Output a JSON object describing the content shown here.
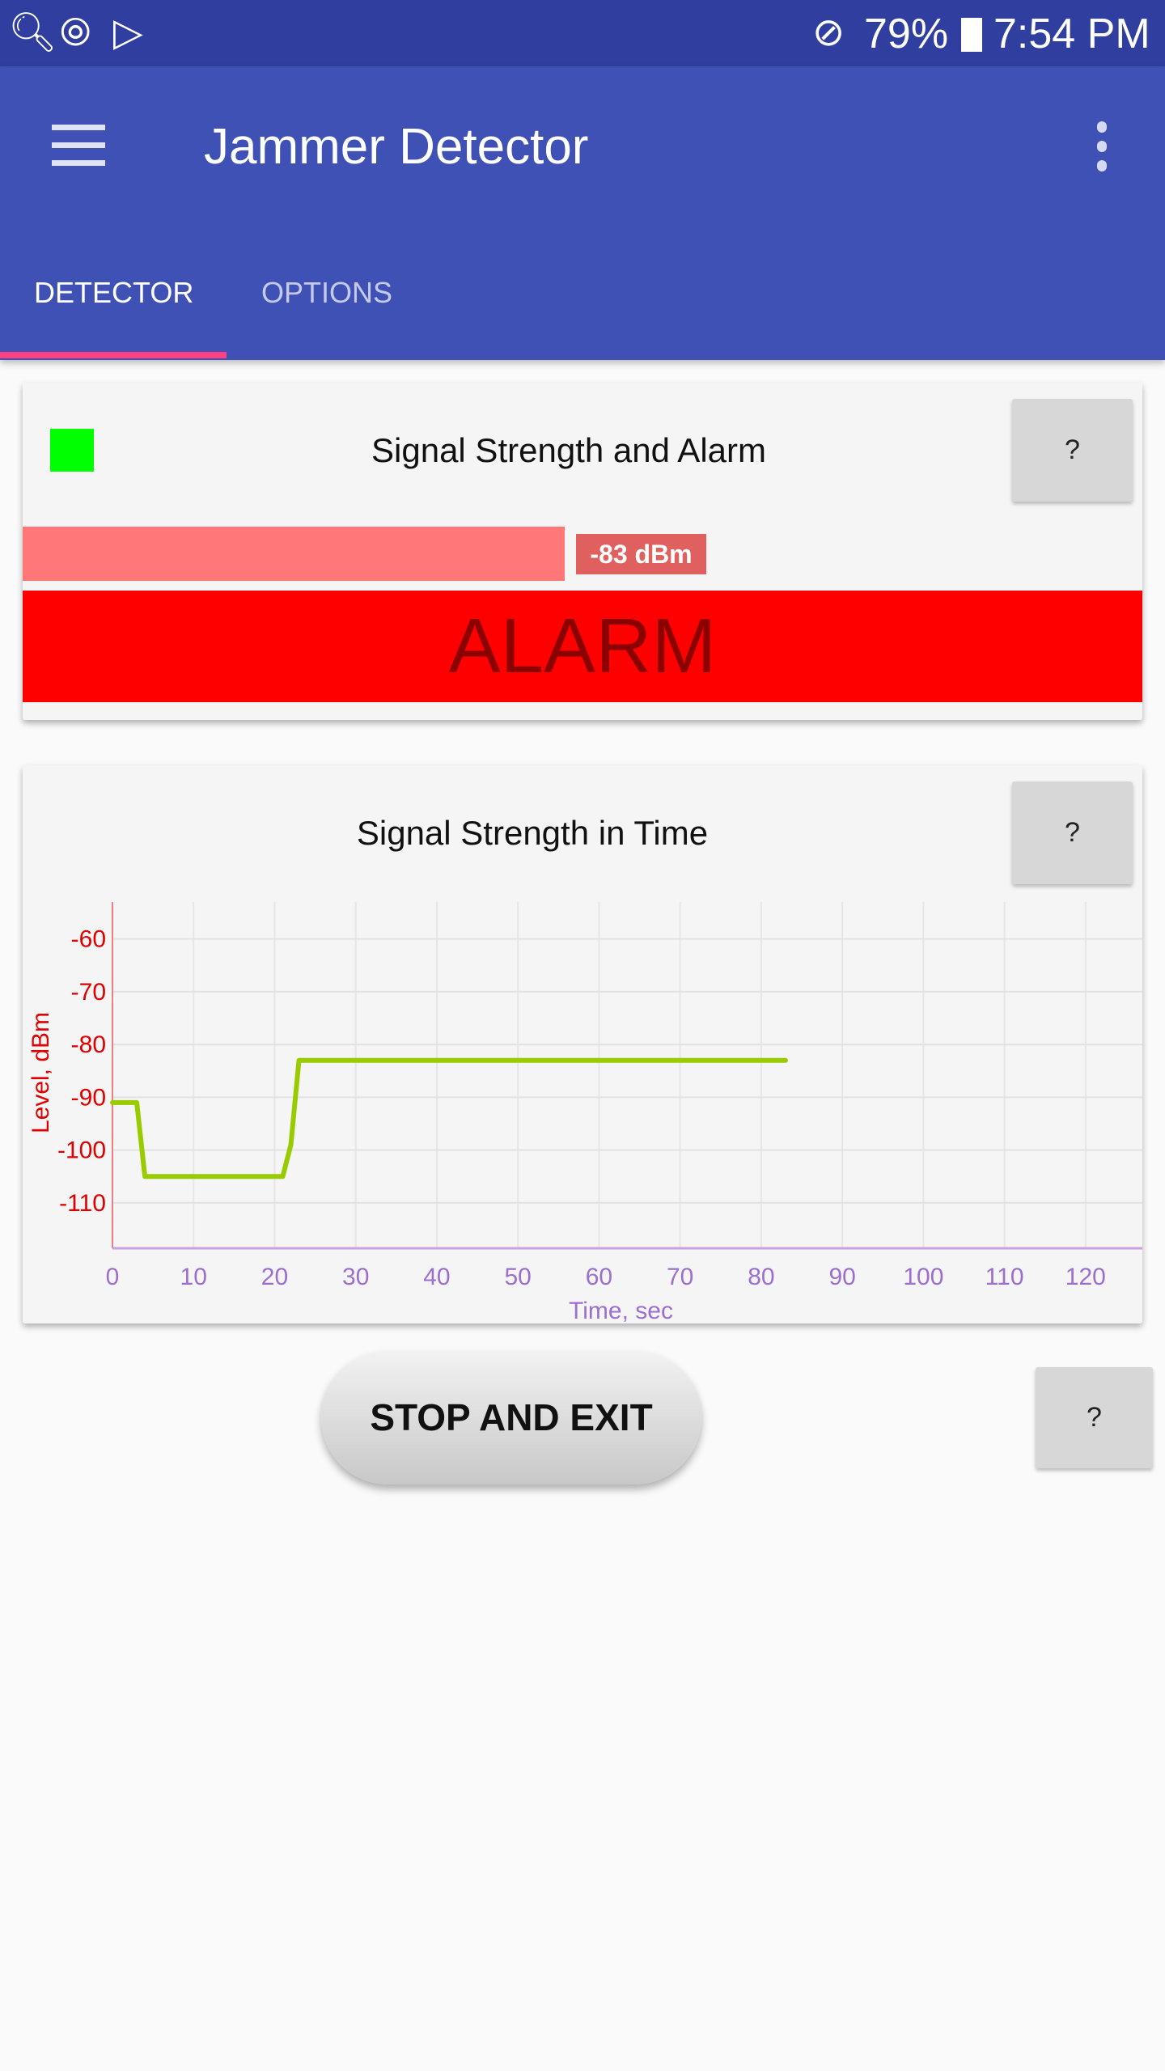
{
  "status_bar": {
    "left_icons": [
      "search-icon",
      "sync-icon",
      "play-store-icon"
    ],
    "mute_icon": "no-sound-icon",
    "battery": "79%",
    "battery_icon": "charging-battery-icon",
    "time": "7:54 PM"
  },
  "app_bar": {
    "title": "Jammer Detector",
    "menu_icon": "hamburger-icon",
    "more_icon": "more-vert-icon"
  },
  "tabs": [
    {
      "label": "DETECTOR",
      "active": true
    },
    {
      "label": "OPTIONS",
      "active": false
    }
  ],
  "colors": {
    "primary": "#3F51B5",
    "primary_dark": "#303F9F",
    "accent": "#FF4081",
    "alarm": "#FF0000",
    "signal_bar": "#FF7777",
    "status_indicator": "#00FF00",
    "line": "#99CC00"
  },
  "signal_card": {
    "title": "Signal Strength and Alarm",
    "help": "?",
    "level_label": "-83 dBm",
    "level_fraction": 0.5,
    "alarm_text": "ALARM"
  },
  "chart_card": {
    "title": "Signal Strength in Time",
    "help": "?"
  },
  "chart_data": {
    "type": "line",
    "xlabel": "Time, sec",
    "ylabel": "Level, dBm",
    "xlim": [
      0,
      127
    ],
    "ylim": [
      -118.6,
      -53
    ],
    "grid": true,
    "xticks": [
      0,
      10,
      20,
      30,
      40,
      50,
      60,
      70,
      80,
      90,
      100,
      110,
      120
    ],
    "yticks": [
      -60,
      -70,
      -80,
      -90,
      -100,
      -110
    ],
    "series": [
      {
        "x": [
          0,
          3,
          4,
          21,
          22,
          23,
          83
        ],
        "y": [
          -91,
          -91,
          -105,
          -105,
          -99,
          -83,
          -83
        ]
      }
    ]
  },
  "stop_button": {
    "label": "STOP AND EXIT",
    "help": "?"
  }
}
